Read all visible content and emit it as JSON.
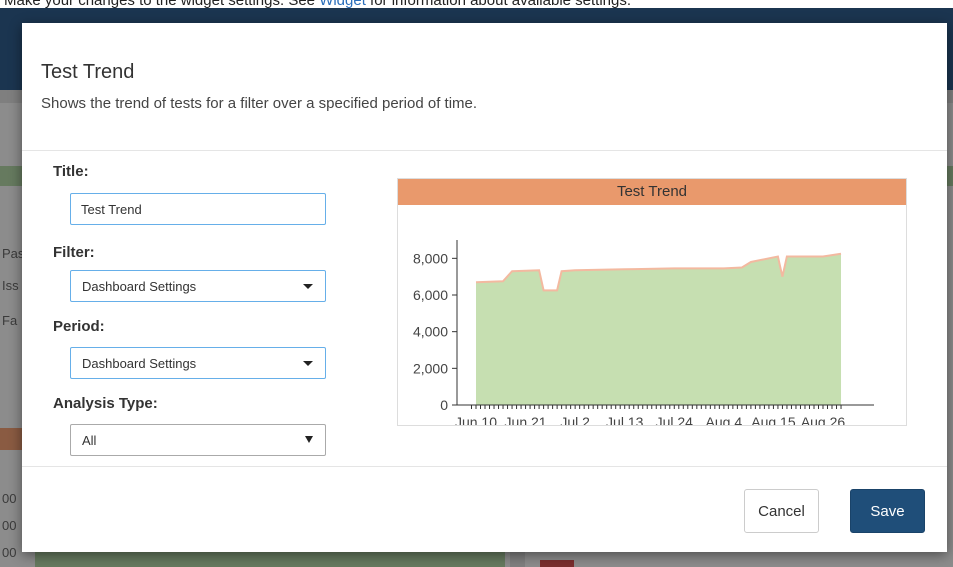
{
  "doc": {
    "caption_before": "Make your changes to the widget settings. See ",
    "caption_link": "Widget",
    "caption_after": " for information about available settings."
  },
  "background": {
    "left_labels": [
      "Pas",
      "Iss",
      "Fa"
    ],
    "bottom_numbers": [
      "00",
      "00",
      "00"
    ]
  },
  "dialog": {
    "title": "Test Trend",
    "description": "Shows the trend of tests for a filter over a specified period of time.",
    "fields": {
      "title_label": "Title:",
      "title_value": "Test Trend",
      "filter_label": "Filter:",
      "filter_value": "Dashboard Settings",
      "period_label": "Period:",
      "period_value": "Dashboard Settings",
      "analysis_label": "Analysis Type:",
      "analysis_value": "All"
    },
    "buttons": {
      "cancel": "Cancel",
      "save": "Save"
    }
  },
  "colors": {
    "area_fill": "#c6dfb1",
    "area_top": "#f3b9a0",
    "chart_header": "#e9996c",
    "save_button": "#1f4e79"
  },
  "chart_data": {
    "type": "area",
    "title": "Test Trend",
    "y_ticks": [
      "0",
      "2,000",
      "4,000",
      "6,000",
      "8,000"
    ],
    "ylim": [
      0,
      9000
    ],
    "x_ticks": [
      "Jun 10",
      "Jun 21",
      "Jul 2",
      "Jul 13",
      "Jul 24",
      "Aug 4",
      "Aug 15",
      "Aug 26"
    ],
    "x": [
      "Jun 10",
      "Jun 16",
      "Jun 18",
      "Jun 24",
      "Jun 25",
      "Jun 28",
      "Jun 29",
      "Jul 2",
      "Jul 13",
      "Jul 24",
      "Aug 4",
      "Aug 8",
      "Aug 10",
      "Aug 16",
      "Aug 17",
      "Aug 18",
      "Aug 26",
      "Aug 30"
    ],
    "values": [
      6700,
      6750,
      7300,
      7350,
      6250,
      6250,
      7300,
      7350,
      7400,
      7450,
      7450,
      7500,
      7800,
      8100,
      7000,
      8100,
      8100,
      8250
    ]
  }
}
